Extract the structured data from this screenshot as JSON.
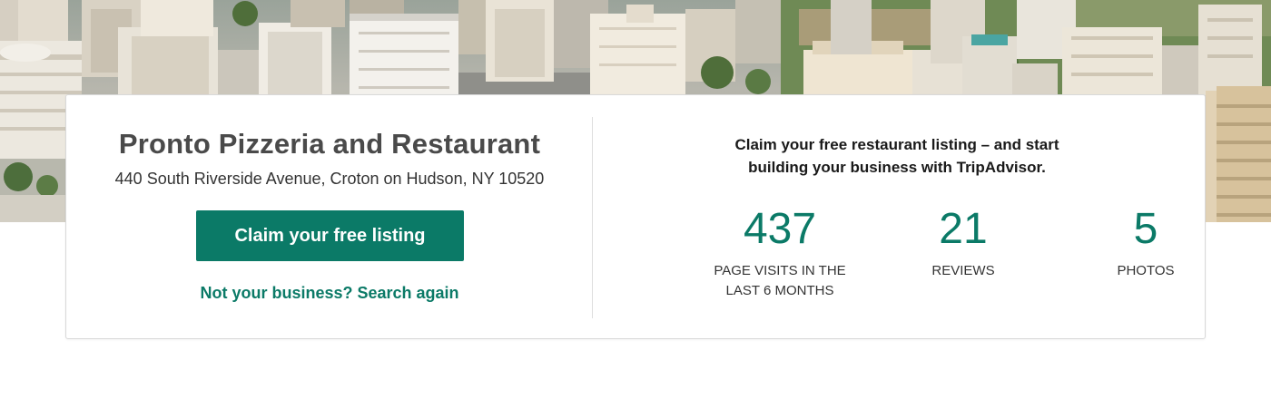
{
  "hero": {
    "image_alt": "aerial city skyline"
  },
  "listing": {
    "name": "Pronto Pizzeria and Restaurant",
    "address": "440 South Riverside Avenue, Croton on Hudson, NY 10520",
    "claim_button_label": "Claim your free listing",
    "search_again_link": "Not your business? Search again"
  },
  "pitch": {
    "line1": "Claim your free restaurant listing – and start",
    "line2": "building your business with TripAdvisor."
  },
  "stats": [
    {
      "value": "437",
      "label_line1": "PAGE VISITS IN THE",
      "label_line2": "LAST 6 MONTHS"
    },
    {
      "value": "21",
      "label_line1": "REVIEWS",
      "label_line2": ""
    },
    {
      "value": "5",
      "label_line1": "PHOTOS",
      "label_line2": ""
    }
  ],
  "colors": {
    "accent": "#0b7a67",
    "heading": "#4a4a4a",
    "text": "#333333",
    "border": "#d9d9d9"
  }
}
